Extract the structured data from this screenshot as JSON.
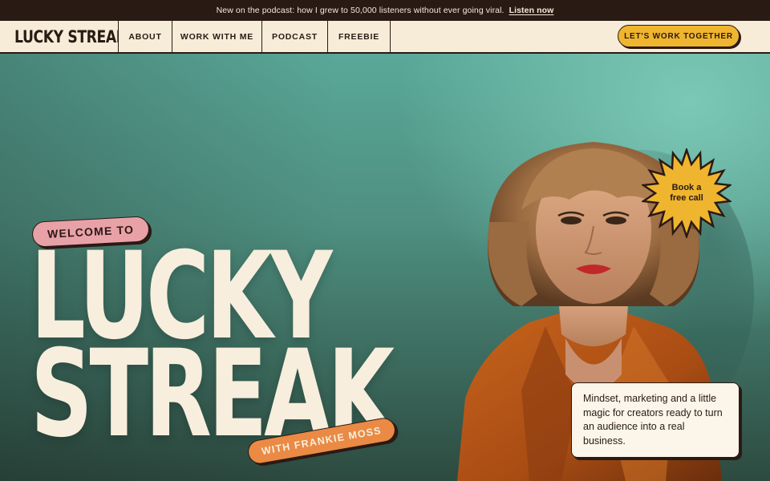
{
  "announcement": {
    "text": "New on the podcast: how I grew to 50,000 listeners without ever going viral.",
    "link": "Listen now"
  },
  "nav": {
    "logo": "LUCKY STREAK",
    "items": [
      {
        "label": "ABOUT"
      },
      {
        "label": "WORK WITH ME"
      },
      {
        "label": "PODCAST"
      },
      {
        "label": "FREEBIE"
      }
    ],
    "cta": "LET'S WORK TOGETHER"
  },
  "hero": {
    "welcome": "WELCOME TO",
    "title_line1": "LUCKY",
    "title_line2": "STREAK",
    "byline": "WITH FRANKIE MOSS",
    "badge_line1": "Book a",
    "badge_line2": "free call",
    "quote": "Mindset, marketing and a little magic for creators ready to turn an audience into a real business."
  },
  "colors": {
    "ink": "#2a1a14",
    "cream": "#f6ecd8",
    "accent_yellow": "#efb52e",
    "accent_pink": "#e9a1a8",
    "accent_orange": "#ea8a45",
    "teal": "#5aa899"
  },
  "icons": {
    "badge_shape": "starburst-icon",
    "portrait": "portrait-image"
  }
}
